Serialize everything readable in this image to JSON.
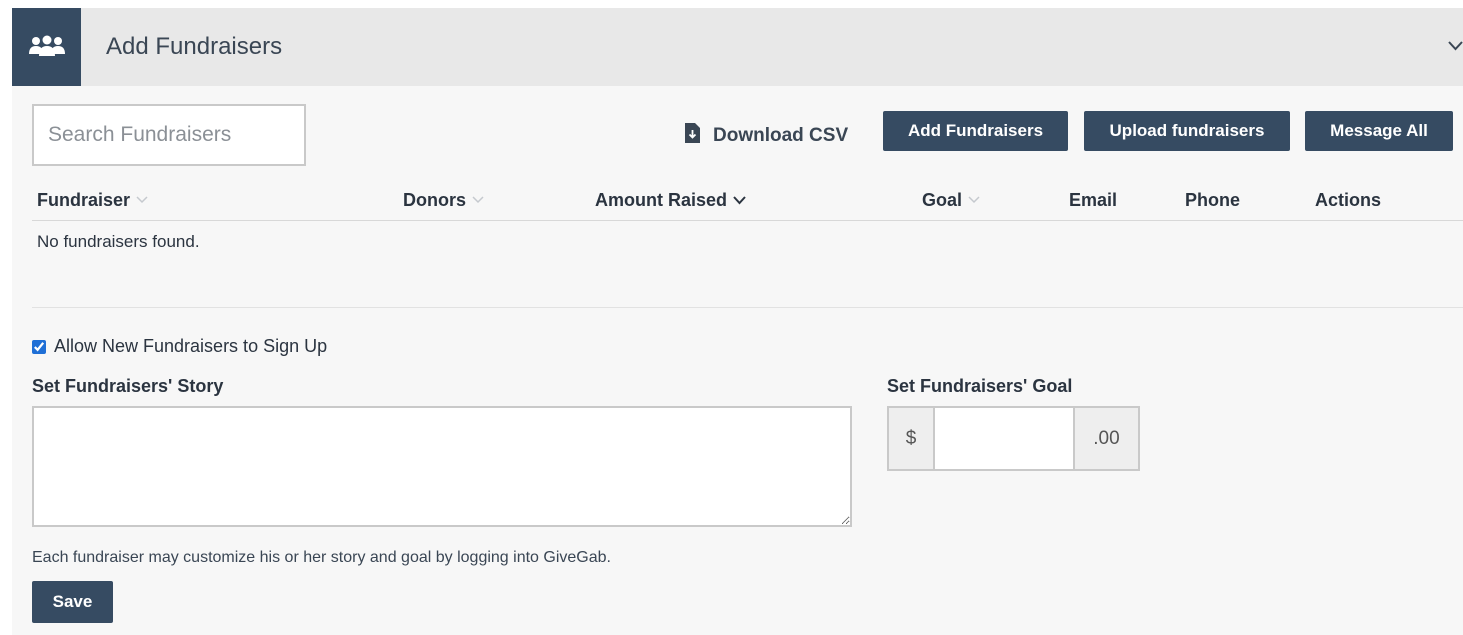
{
  "header": {
    "title": "Add Fundraisers",
    "icon": "users-icon",
    "collapse_icon": "chevron-down-icon"
  },
  "toolbar": {
    "search_placeholder": "Search Fundraisers",
    "search_value": "",
    "download_csv_label": "Download CSV",
    "add_fundraisers_label": "Add Fundraisers",
    "upload_fundraisers_label": "Upload fundraisers",
    "message_all_label": "Message All"
  },
  "table": {
    "columns": [
      {
        "label": "Fundraiser",
        "sort": "inactive"
      },
      {
        "label": "Donors",
        "sort": "inactive"
      },
      {
        "label": "Amount Raised",
        "sort": "active"
      },
      {
        "label": "Goal",
        "sort": "inactive"
      },
      {
        "label": "Email"
      },
      {
        "label": "Phone"
      },
      {
        "label": "Actions"
      }
    ],
    "empty_message": "No fundraisers found.",
    "rows": []
  },
  "settings": {
    "allow_signup_label": "Allow New Fundraisers to Sign Up",
    "allow_signup_checked": true,
    "story_label": "Set Fundraisers' Story",
    "story_value": "",
    "goal_label": "Set Fundraisers' Goal",
    "goal_prefix": "$",
    "goal_value": "",
    "goal_suffix": ".00",
    "hint": "Each fundraiser may customize his or her story and goal by logging into GiveGab.",
    "save_label": "Save"
  },
  "colors": {
    "primary": "#364b62",
    "header_bg": "#e8e8e8",
    "panel_bg": "#f7f7f7",
    "checkbox": "#1f6fd6"
  }
}
